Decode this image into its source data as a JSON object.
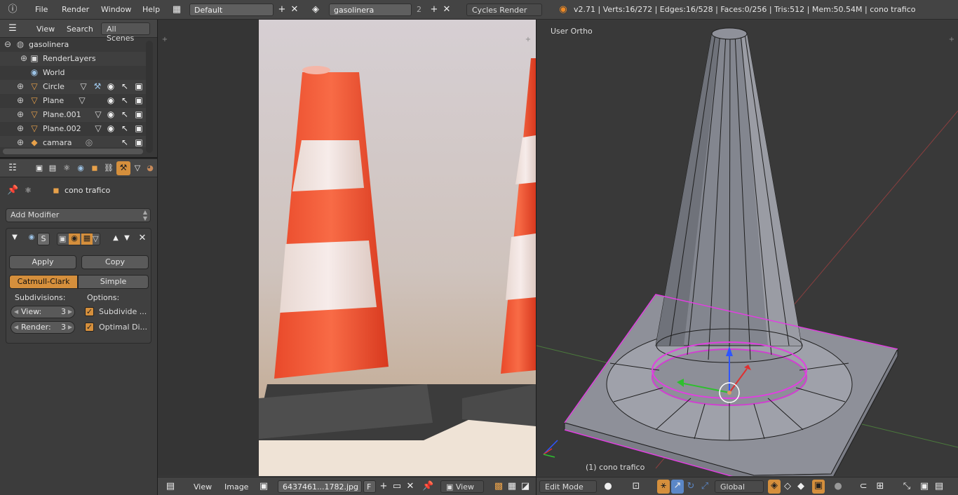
{
  "topbar": {
    "menus": [
      "File",
      "Render",
      "Window",
      "Help"
    ],
    "layout_name": "Default",
    "scene_name": "gasolinera",
    "scene_users": "2",
    "render_engine": "Cycles Render",
    "stats": "v2.71 | Verts:16/272 | Edges:16/528 | Faces:0/256 | Tris:512 | Mem:50.54M | cono trafico"
  },
  "outliner": {
    "header": {
      "view": "View",
      "search": "Search",
      "filter": "All Scenes"
    },
    "items": [
      {
        "label": "gasolinera",
        "icon": "scene-icon"
      },
      {
        "label": "RenderLayers",
        "icon": "renderlayers-icon"
      },
      {
        "label": "World",
        "icon": "world-icon"
      },
      {
        "label": "Circle",
        "icon": "mesh-icon"
      },
      {
        "label": "Plane",
        "icon": "mesh-icon"
      },
      {
        "label": "Plane.001",
        "icon": "mesh-icon"
      },
      {
        "label": "Plane.002",
        "icon": "mesh-icon"
      },
      {
        "label": "camara",
        "icon": "camera-icon"
      }
    ]
  },
  "properties": {
    "object_name": "cono trafico",
    "add_modifier": "Add Modifier",
    "apply": "Apply",
    "copy": "Copy",
    "catmull_clark": "Catmull-Clark",
    "simple": "Simple",
    "subdivisions_label": "Subdivisions:",
    "options_label": "Options:",
    "view_label": "View:",
    "view_value": "3",
    "render_label": "Render:",
    "render_value": "3",
    "subdivide_uvs": "Subdivide ...",
    "optimal_display": "Optimal Di..."
  },
  "image_editor": {
    "view": "View",
    "image": "Image",
    "image_name": "6437461...1782.jpg",
    "fake_user": "F",
    "view_dropdown": "View"
  },
  "viewport": {
    "projection_label": "User Ortho",
    "object_label": "(1) cono trafico",
    "mode": "Edit Mode",
    "orientation": "Global"
  },
  "colors": {
    "accent": "#d58f3c",
    "selection": "#e040e0",
    "x_axis": "#c62828",
    "y_axis": "#2e7d32"
  }
}
